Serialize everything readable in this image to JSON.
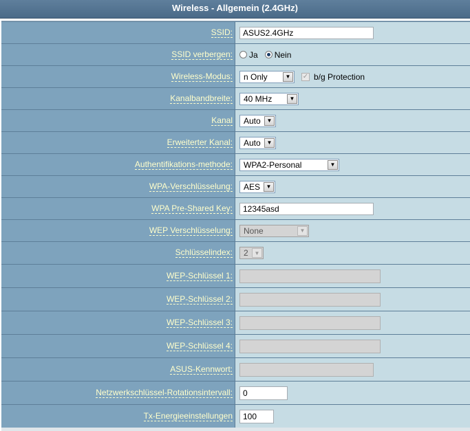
{
  "title": "Wireless - Allgemein (2.4GHz)",
  "fields": {
    "ssid": {
      "label": "SSID:",
      "value": "ASUS2.4GHz"
    },
    "hide_ssid": {
      "label": "SSID verbergen:",
      "opt_yes": "Ja",
      "opt_no": "Nein",
      "selected": "Nein"
    },
    "mode": {
      "label": "Wireless-Modus:",
      "value": "n Only",
      "protection_label": "b/g Protection"
    },
    "bandwidth": {
      "label": "Kanalbandbreite:",
      "value": "40 MHz"
    },
    "channel": {
      "label": "Kanal",
      "value": "Auto"
    },
    "ext_channel": {
      "label": "Erweiterter Kanal:",
      "value": "Auto"
    },
    "auth": {
      "label": "Authentifikations-methode:",
      "value": "WPA2-Personal"
    },
    "wpa_enc": {
      "label": "WPA-Verschlüsselung:",
      "value": "AES"
    },
    "psk": {
      "label": "WPA Pre-Shared Key:",
      "value": "12345asd"
    },
    "wep_enc": {
      "label": "WEP Verschlüsselung:",
      "value": "None"
    },
    "key_index": {
      "label": "Schlüsselindex:",
      "value": "2"
    },
    "wep1": {
      "label": "WEP-Schlüssel 1:",
      "value": ""
    },
    "wep2": {
      "label": "WEP-Schlüssel 2:",
      "value": ""
    },
    "wep3": {
      "label": "WEP-Schlüssel 3:",
      "value": ""
    },
    "wep4": {
      "label": "WEP-Schlüssel 4:",
      "value": ""
    },
    "asus_pw": {
      "label": "ASUS-Kennwort:",
      "value": ""
    },
    "rotation": {
      "label": "Netzwerkschlüssel-Rotationsintervall:",
      "value": "0"
    },
    "tx_power": {
      "label": "Tx-Energieeinstellungen",
      "value": "100"
    }
  },
  "icons": {
    "dropdown": "chevron-down-icon",
    "radio": "radio-icon",
    "checkbox": "checkbox-icon"
  },
  "colors": {
    "title_bg": "#4f6f8d",
    "label_bg": "#7ea3bd",
    "value_bg": "#c6dce4",
    "label_text": "#ffffcc"
  }
}
